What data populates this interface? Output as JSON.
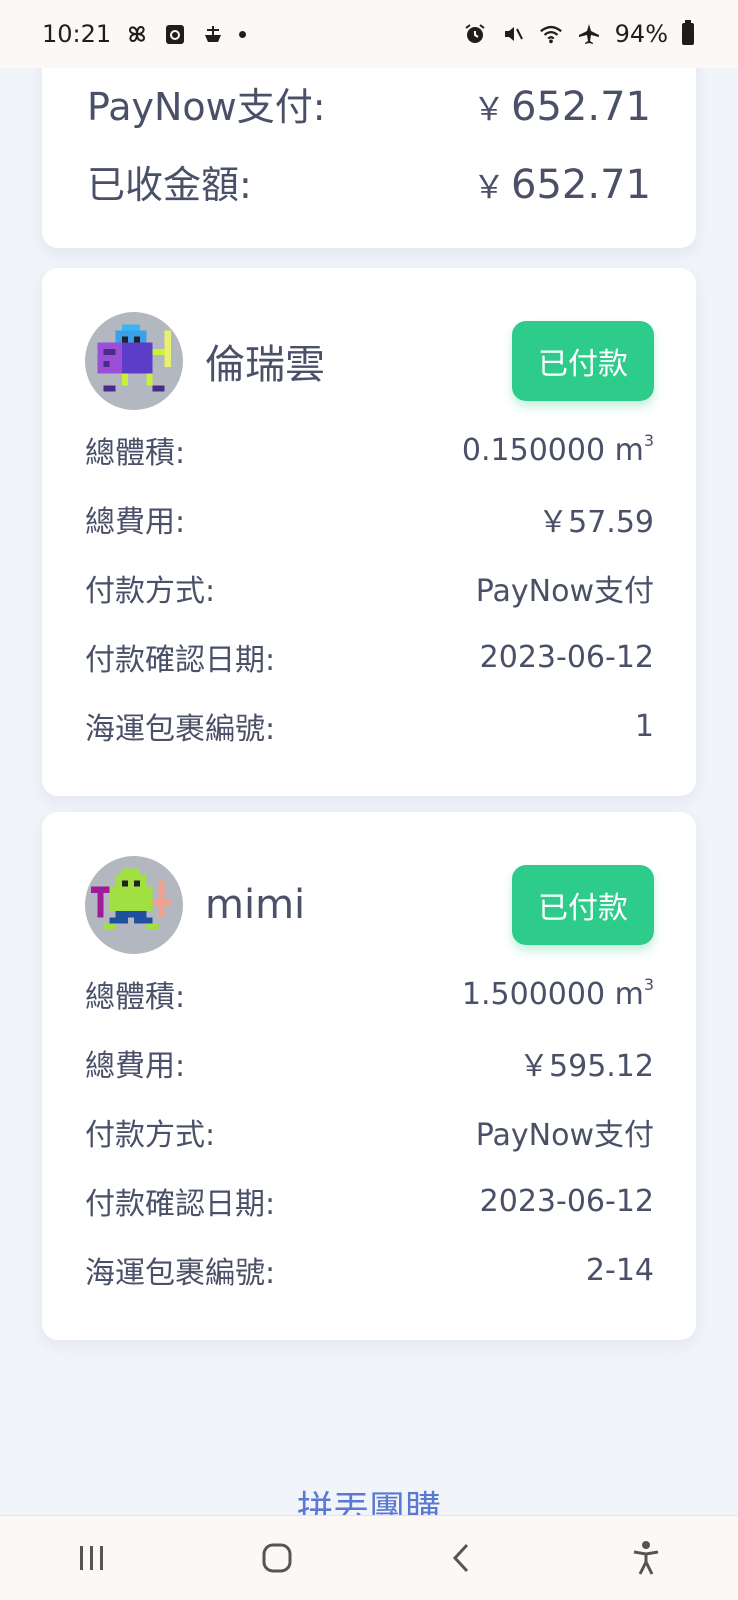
{
  "status_bar": {
    "time": "10:21",
    "battery": "94%",
    "left_icons": [
      "pinwheel-icon",
      "calendar-app-icon",
      "ship-icon",
      "notification-dot"
    ],
    "right_icons": [
      "alarm-icon",
      "vibrate-mute-icon",
      "wifi-icon",
      "airplane-icon",
      "battery-icon"
    ]
  },
  "summary": {
    "paynow_label": "PayNow支付:",
    "paynow_currency": "￥",
    "paynow_amount": "652.71",
    "received_label": "已收金額:",
    "received_currency": "￥",
    "received_amount": "652.71"
  },
  "users": [
    {
      "name": "倫瑞雲",
      "status": "已付款",
      "avatar": "pixel-knight-avatar-icon",
      "volume_label": "總體積:",
      "volume_value": "0.150000 m",
      "volume_unit_sup": "3",
      "fee_label": "總費用:",
      "fee_value": "￥57.59",
      "method_label": "付款方式:",
      "method_value": "PayNow支付",
      "date_label": "付款確認日期:",
      "date_value": "2023-06-12",
      "parcel_label": "海運包裹編號:",
      "parcel_value": "1"
    },
    {
      "name": "mimi",
      "status": "已付款",
      "avatar": "pixel-goblin-avatar-icon",
      "volume_label": "總體積:",
      "volume_value": "1.500000 m",
      "volume_unit_sup": "3",
      "fee_label": "總費用:",
      "fee_value": "￥595.12",
      "method_label": "付款方式:",
      "method_value": "PayNow支付",
      "date_label": "付款確認日期:",
      "date_value": "2023-06-12",
      "parcel_label": "海運包裹編號:",
      "parcel_value": "2-14"
    }
  ],
  "footer": {
    "link_label": "拼丟團購"
  },
  "nav": {
    "icons": [
      "recent-apps-icon",
      "home-icon",
      "back-icon",
      "accessibility-icon"
    ]
  },
  "colors": {
    "paid_badge": "#2ecc8a",
    "text": "#4a5068",
    "link": "#5b78d2",
    "background": "#f1f4f9"
  }
}
